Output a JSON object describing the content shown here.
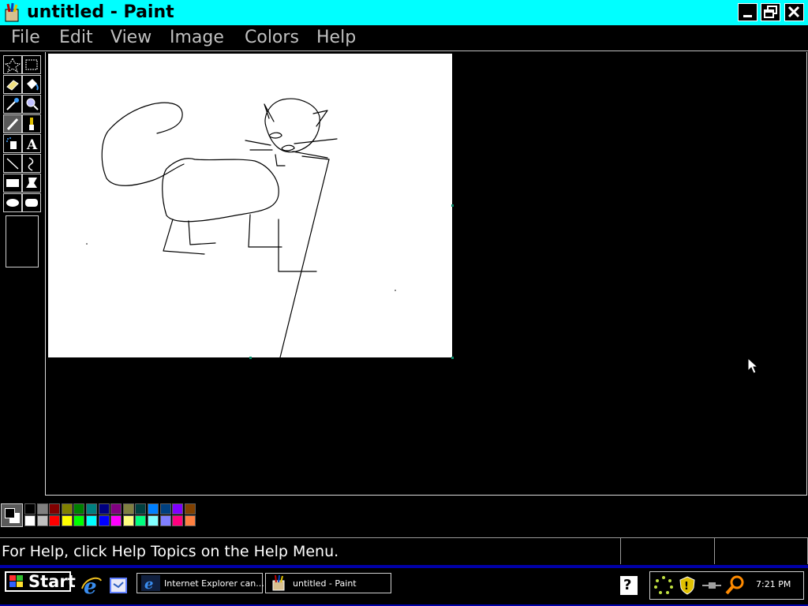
{
  "window": {
    "title": "untitled - Paint",
    "controls": [
      "minimize",
      "restore",
      "close"
    ]
  },
  "menu": {
    "file": "File",
    "edit": "Edit",
    "view": "View",
    "image": "Image",
    "colors": "Colors",
    "help": "Help"
  },
  "toolbox": {
    "tools": [
      {
        "name": "free-form-select",
        "icon": "star-select-icon"
      },
      {
        "name": "select",
        "icon": "rect-select-icon"
      },
      {
        "name": "eraser",
        "icon": "eraser-icon"
      },
      {
        "name": "fill",
        "icon": "fill-bucket-icon"
      },
      {
        "name": "pick-color",
        "icon": "eyedropper-icon"
      },
      {
        "name": "magnifier",
        "icon": "magnifier-icon"
      },
      {
        "name": "pencil",
        "icon": "pencil-icon",
        "active": true
      },
      {
        "name": "brush",
        "icon": "brush-icon"
      },
      {
        "name": "airbrush",
        "icon": "airbrush-icon"
      },
      {
        "name": "text",
        "icon": "text-icon",
        "label": "A"
      },
      {
        "name": "line",
        "icon": "line-icon"
      },
      {
        "name": "curve",
        "icon": "curve-icon"
      },
      {
        "name": "rectangle",
        "icon": "rectangle-icon"
      },
      {
        "name": "polygon",
        "icon": "polygon-icon"
      },
      {
        "name": "ellipse",
        "icon": "ellipse-icon"
      },
      {
        "name": "rounded-rectangle",
        "icon": "rounded-rect-icon"
      }
    ]
  },
  "palette": {
    "foreground": "#000000",
    "background": "#ffffff",
    "row1": [
      "#000000",
      "#808080",
      "#800000",
      "#808000",
      "#008000",
      "#008080",
      "#000080",
      "#800080",
      "#808040",
      "#004040",
      "#0080ff",
      "#004080",
      "#8000ff",
      "#804000"
    ],
    "row2": [
      "#ffffff",
      "#c0c0c0",
      "#ff0000",
      "#ffff00",
      "#00ff00",
      "#00ffff",
      "#0000ff",
      "#ff00ff",
      "#ffff80",
      "#00ff80",
      "#80ffff",
      "#8080ff",
      "#ff0080",
      "#ff8040"
    ]
  },
  "status": {
    "help_text": "For Help, click Help Topics on the Help Menu."
  },
  "taskbar": {
    "start_label": "Start",
    "tasks": [
      {
        "label": "Internet Explorer can...",
        "icon": "internet-explorer-icon"
      },
      {
        "label": "untitled - Paint",
        "icon": "paint-icon"
      }
    ],
    "clock": "7:21 PM",
    "help_label": "?"
  },
  "colors": {
    "title_bar": "#00ffff",
    "taskbar_edge": "#0000a8",
    "canvas": "#ffffff"
  }
}
